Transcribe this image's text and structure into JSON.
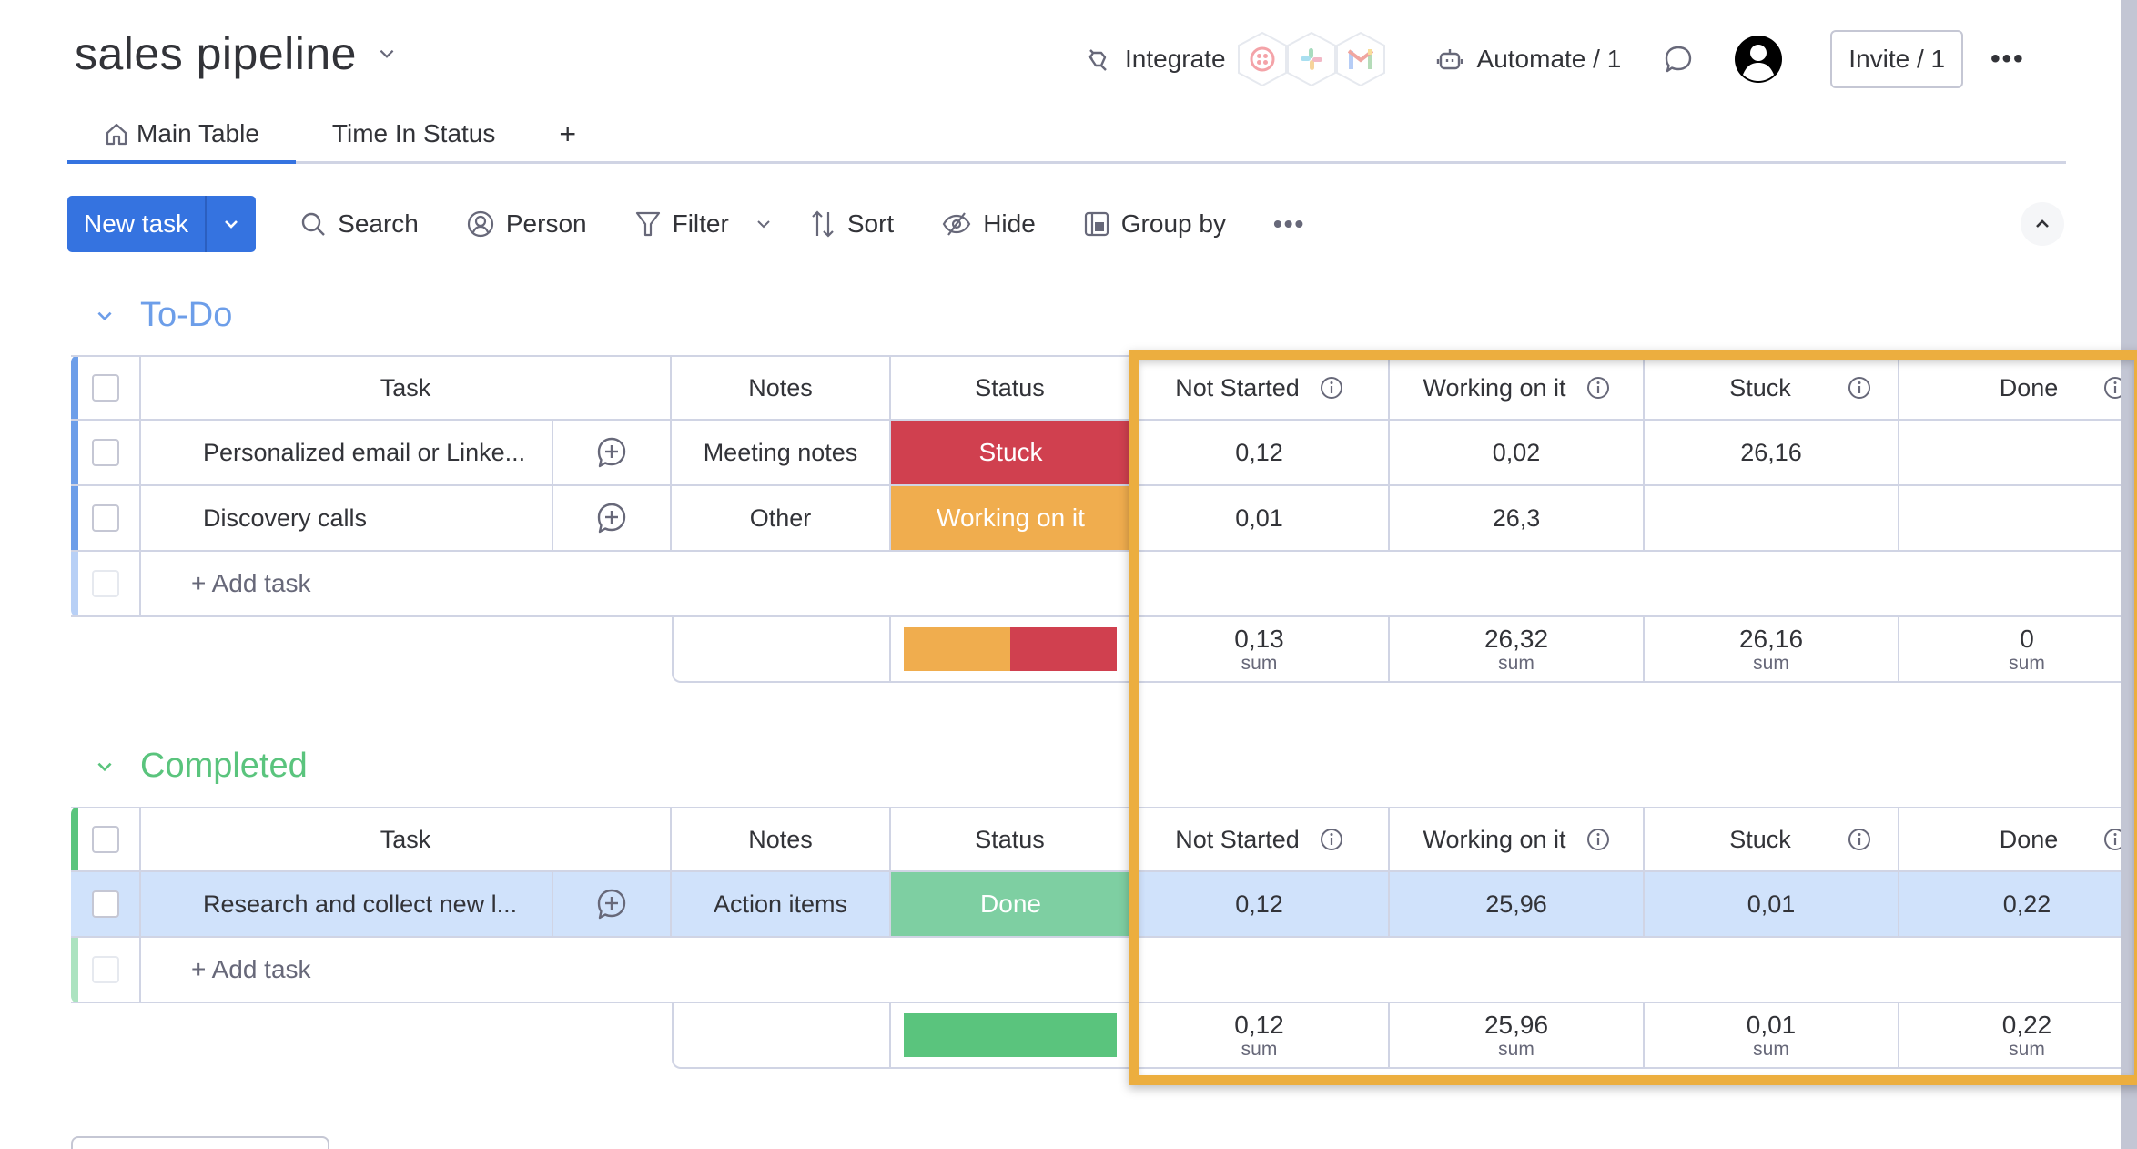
{
  "header": {
    "board_title": "sales pipeline",
    "integrate_label": "Integrate",
    "integration_icons": [
      "twilio-icon",
      "slack-icon",
      "gmail-icon"
    ],
    "automate_label": "Automate / 1",
    "invite_label": "Invite / 1",
    "more_label": "•••"
  },
  "tabs": [
    {
      "label": "Main Table",
      "active": true,
      "icon": "home-icon"
    },
    {
      "label": "Time In Status",
      "active": false
    },
    {
      "label": "+",
      "active": false
    }
  ],
  "toolbar": {
    "new_task_label": "New task",
    "search_label": "Search",
    "person_label": "Person",
    "filter_label": "Filter",
    "sort_label": "Sort",
    "hide_label": "Hide",
    "group_by_label": "Group by",
    "more_label": "•••"
  },
  "columns": {
    "task": "Task",
    "notes": "Notes",
    "status": "Status",
    "not_started": "Not Started",
    "working_on_it": "Working on it",
    "stuck": "Stuck",
    "done": "Done"
  },
  "colors": {
    "accent": "#3573e0",
    "todo_group": "#6d9ee9",
    "completed_group": "#5ac47d",
    "status_stuck": "#d0404f",
    "status_working": "#f0ad4e",
    "status_done": "#7ecfa2",
    "summary_done": "#5ac47d",
    "highlight": "#ecae3f",
    "selected_row": "#d0e2fb"
  },
  "groups": [
    {
      "title": "To-Do",
      "rows": [
        {
          "task": "Personalized email or Linke...",
          "notes": "Meeting notes",
          "status": "Stuck",
          "not_started": "0,12",
          "working_on_it": "0,02",
          "stuck": "26,16",
          "done": ""
        },
        {
          "task": "Discovery calls",
          "notes": "Other",
          "status": "Working on it",
          "not_started": "0,01",
          "working_on_it": "26,3",
          "stuck": "",
          "done": ""
        }
      ],
      "add_task_label": "+ Add task",
      "summary": {
        "status_distribution": [
          {
            "status": "Working on it",
            "fraction": 0.5
          },
          {
            "status": "Stuck",
            "fraction": 0.5
          }
        ],
        "not_started": "0,13",
        "working_on_it": "26,32",
        "stuck": "26,16",
        "done": "0",
        "label": "sum"
      }
    },
    {
      "title": "Completed",
      "rows": [
        {
          "task": "Research and collect new l...",
          "notes": "Action items",
          "status": "Done",
          "not_started": "0,12",
          "working_on_it": "25,96",
          "stuck": "0,01",
          "done": "0,22",
          "selected": true
        }
      ],
      "add_task_label": "+ Add task",
      "summary": {
        "status_distribution": [
          {
            "status": "Done",
            "fraction": 1.0
          }
        ],
        "not_started": "0,12",
        "working_on_it": "25,96",
        "stuck": "0,01",
        "done": "0,22",
        "label": "sum"
      }
    }
  ]
}
